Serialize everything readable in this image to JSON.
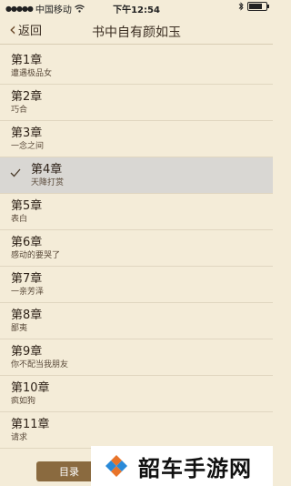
{
  "status_bar": {
    "carrier": "中国移动",
    "time": "下午12:54"
  },
  "nav": {
    "back_label": "返回",
    "title": "书中自有颜如玉"
  },
  "chapters": [
    {
      "title": "第1章",
      "subtitle": "遭遇极品女"
    },
    {
      "title": "第2章",
      "subtitle": "巧合"
    },
    {
      "title": "第3章",
      "subtitle": "一念之间"
    },
    {
      "title": "第4章",
      "subtitle": "天降打赏",
      "selected": true
    },
    {
      "title": "第5章",
      "subtitle": "表白"
    },
    {
      "title": "第6章",
      "subtitle": "感动的要哭了"
    },
    {
      "title": "第7章",
      "subtitle": "一亲芳泽"
    },
    {
      "title": "第8章",
      "subtitle": "鄙夷"
    },
    {
      "title": "第9章",
      "subtitle": "你不配当我朋友"
    },
    {
      "title": "第10章",
      "subtitle": "疯如狗"
    },
    {
      "title": "第11章",
      "subtitle": "请求"
    }
  ],
  "bottom": {
    "toc_label": "目录"
  },
  "watermark": {
    "text": "韶车手游网"
  },
  "colors": {
    "background": "#f4ecd8",
    "selected_row": "#d9d7d3",
    "button": "#8a6a3f"
  }
}
